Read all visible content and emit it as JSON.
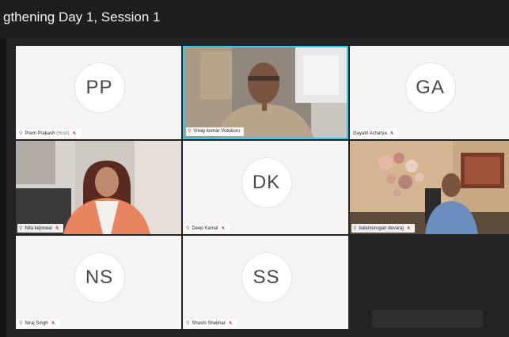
{
  "window": {
    "title": "gthening Day 1, Session 1"
  },
  "participants": [
    {
      "id": "pp",
      "initials": "PP",
      "name": "Prem Prakash",
      "role": "(Host)",
      "video": false
    },
    {
      "id": "vk",
      "initials": "",
      "name": "Vinay kumar Vutukuru",
      "role": "",
      "video": true,
      "active_speaker": true
    },
    {
      "id": "ga",
      "initials": "GA",
      "name": "Gayatri Acharya",
      "role": "",
      "video": false
    },
    {
      "id": "nk",
      "initials": "",
      "name": "Nita kejrewal",
      "role": "",
      "video": true
    },
    {
      "id": "dk",
      "initials": "DK",
      "name": "Deep Kamal",
      "role": "",
      "video": false
    },
    {
      "id": "bd",
      "initials": "",
      "name": "balamurugan devaraj",
      "role": "",
      "video": true
    },
    {
      "id": "ns",
      "initials": "NS",
      "name": "Niraj Singh",
      "role": "",
      "video": false
    },
    {
      "id": "ss",
      "initials": "SS",
      "name": "Shashi Shekhar",
      "role": "",
      "video": false
    }
  ],
  "icons": {
    "muted_mic": "mic-muted-icon",
    "signal": "signal-icon",
    "host": "host-icon"
  },
  "colors": {
    "active_border": "#2ecdf3",
    "muted_mic": "#e0393e",
    "tile_bg": "#f4f4f4"
  }
}
